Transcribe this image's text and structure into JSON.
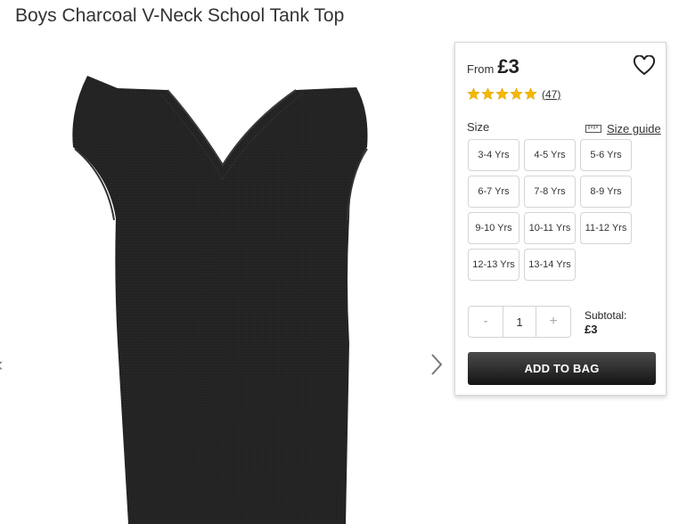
{
  "product": {
    "title": "Boys Charcoal V-Neck School Tank Top",
    "image_alt_icon": "tank-top-image",
    "garment_color": "#1f1f1f"
  },
  "gallery": {
    "prev_icon": "chevron-left-icon",
    "next_icon": "chevron-right-icon"
  },
  "panel": {
    "from_label": "From",
    "price": "£3",
    "wishlist_icon": "heart-icon",
    "rating": {
      "stars": 5,
      "max": 5,
      "count": "(47)",
      "star_color": "#f5b800"
    },
    "size_label": "Size",
    "size_guide_label": "Size guide",
    "sizes": [
      "3-4 Yrs",
      "4-5 Yrs",
      "5-6 Yrs",
      "6-7 Yrs",
      "7-8 Yrs",
      "8-9 Yrs",
      "9-10 Yrs",
      "10-11 Yrs",
      "11-12 Yrs",
      "12-13 Yrs",
      "13-14 Yrs"
    ],
    "quantity": {
      "minus": "-",
      "value": "1",
      "plus": "+"
    },
    "subtotal_label": "Subtotal:",
    "subtotal_value": "£3",
    "add_to_bag": "ADD TO BAG",
    "button_color": "#1e1e1e"
  }
}
